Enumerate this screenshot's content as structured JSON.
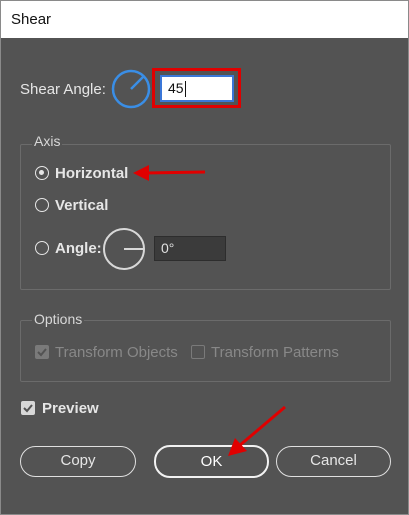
{
  "window": {
    "title": "Shear"
  },
  "shear_angle": {
    "label": "Shear Angle:",
    "value": "45"
  },
  "axis": {
    "legend": "Axis",
    "horizontal_label": "Horizontal",
    "vertical_label": "Vertical",
    "angle_label": "Angle:",
    "angle_value": "0°",
    "selected": "Horizontal"
  },
  "options": {
    "legend": "Options",
    "transform_objects_label": "Transform Objects",
    "transform_objects_checked": true,
    "transform_patterns_label": "Transform Patterns",
    "transform_patterns_checked": false,
    "enabled": false
  },
  "preview": {
    "label": "Preview",
    "checked": true
  },
  "buttons": {
    "copy": "Copy",
    "ok": "OK",
    "cancel": "Cancel"
  },
  "colors": {
    "dialog_bg": "#535353",
    "accent_blue": "#3a8ee6",
    "annotation_red": "#e00000"
  }
}
